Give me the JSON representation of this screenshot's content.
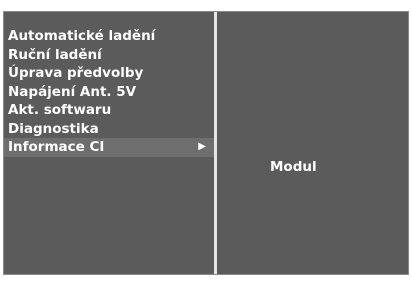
{
  "menu": {
    "items": [
      {
        "label": "Automatické ladění"
      },
      {
        "label": "Ruční ladění"
      },
      {
        "label": "Úprava předvolby"
      },
      {
        "label": "Napájení Ant. 5V"
      },
      {
        "label": "Akt. softwaru"
      },
      {
        "label": "Diagnostika"
      },
      {
        "label": "Informace CI",
        "selected": true
      }
    ],
    "selected_arrow": "▶"
  },
  "submenu": {
    "value": "Modul"
  },
  "colors": {
    "background": "#5b5b5b",
    "selected_row": "#6e6e6e",
    "divider": "#e6e6e6",
    "text": "#ffffff"
  }
}
